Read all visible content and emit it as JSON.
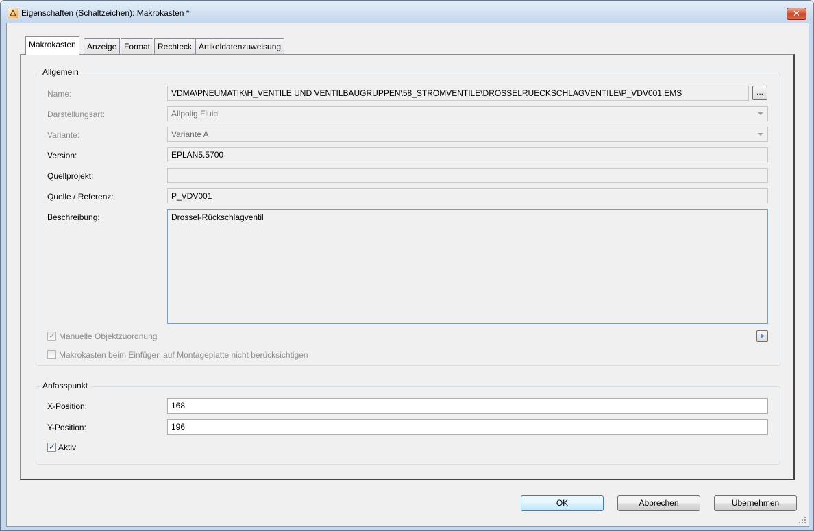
{
  "window": {
    "title": "Eigenschaften (Schaltzeichen): Makrokasten *",
    "close_label": "✕"
  },
  "tabs": [
    {
      "label": "Makrokasten",
      "active": true
    },
    {
      "label": "Anzeige",
      "active": false
    },
    {
      "label": "Format",
      "active": false
    },
    {
      "label": "Rechteck",
      "active": false
    },
    {
      "label": "Artikeldatenzuweisung",
      "active": false
    }
  ],
  "allgemein": {
    "title": "Allgemein",
    "name": {
      "label": "Name:",
      "value": "VDMA\\PNEUMATIK\\H_VENTILE UND VENTILBAUGRUPPEN\\58_STROMVENTILE\\DROSSELRUECKSCHLAGVENTILE\\P_VDV001.EMS",
      "browse_label": "..."
    },
    "darstellungsart": {
      "label": "Darstellungsart:",
      "value": "Allpolig Fluid"
    },
    "variante": {
      "label": "Variante:",
      "value": "Variante A"
    },
    "version": {
      "label": "Version:",
      "value": "EPLAN5.5700"
    },
    "quellprojekt": {
      "label": "Quellprojekt:",
      "value": ""
    },
    "quelle": {
      "label": "Quelle / Referenz:",
      "value": "P_VDV001"
    },
    "beschreibung": {
      "label": "Beschreibung:",
      "value": "Drossel-Rückschlagventil"
    },
    "manuelle": {
      "label": "Manuelle Objektzuordnung",
      "checked": true
    },
    "makrokasten_einfuegen": {
      "label": "Makrokasten beim Einfügen auf Montageplatte nicht berücksichtigen",
      "checked": false
    }
  },
  "anfasspunkt": {
    "title": "Anfasspunkt",
    "x": {
      "label": "X-Position:",
      "value": "168"
    },
    "y": {
      "label": "Y-Position:",
      "value": "196"
    },
    "aktiv": {
      "label": "Aktiv",
      "checked": true
    }
  },
  "buttons": {
    "ok": "OK",
    "cancel": "Abbrechen",
    "apply": "Übernehmen"
  },
  "icons": {
    "title": "eplan-app-icon",
    "arrow": "play-arrow-icon",
    "grip": "resize-grip-icon"
  }
}
